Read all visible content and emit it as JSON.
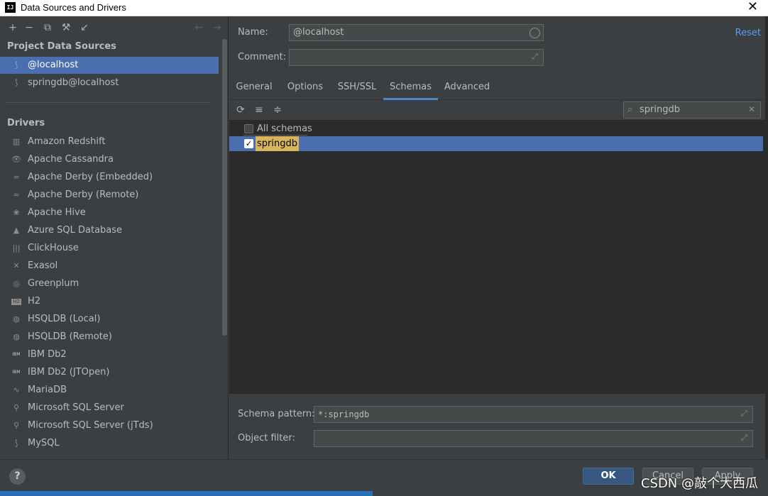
{
  "window": {
    "title": "Data Sources and Drivers",
    "app_icon": "IJ",
    "close_icon": "✕"
  },
  "left_toolbar": {
    "icons": [
      "add-icon",
      "remove-icon",
      "copy-icon",
      "wrench-icon",
      "import-icon",
      "back-arrow-icon",
      "forward-arrow-icon"
    ]
  },
  "project_sources": {
    "title": "Project Data Sources",
    "items": [
      {
        "label": "@localhost",
        "selected": true
      },
      {
        "label": "springdb@localhost",
        "selected": false
      }
    ]
  },
  "drivers": {
    "title": "Drivers",
    "items": [
      {
        "label": "Amazon Redshift",
        "icon": "▥"
      },
      {
        "label": "Apache Cassandra",
        "icon": "👁"
      },
      {
        "label": "Apache Derby (Embedded)",
        "icon": "≈"
      },
      {
        "label": "Apache Derby (Remote)",
        "icon": "≈"
      },
      {
        "label": "Apache Hive",
        "icon": "❀"
      },
      {
        "label": "Azure SQL Database",
        "icon": "▲"
      },
      {
        "label": "ClickHouse",
        "icon": "|||"
      },
      {
        "label": "Exasol",
        "icon": "✕"
      },
      {
        "label": "Greenplum",
        "icon": "◎"
      },
      {
        "label": "H2",
        "icon": "H2"
      },
      {
        "label": "HSQLDB (Local)",
        "icon": "◍"
      },
      {
        "label": "HSQLDB (Remote)",
        "icon": "◍"
      },
      {
        "label": "IBM Db2",
        "icon": "IBM"
      },
      {
        "label": "IBM Db2 (JTOpen)",
        "icon": "IBM"
      },
      {
        "label": "MariaDB",
        "icon": "∿"
      },
      {
        "label": "Microsoft SQL Server",
        "icon": "⚲"
      },
      {
        "label": "Microsoft SQL Server (jTds)",
        "icon": "⚲"
      },
      {
        "label": "MySQL",
        "icon": "⟆"
      }
    ]
  },
  "form": {
    "name_label": "Name:",
    "name_value": "@localhost",
    "comment_label": "Comment:",
    "comment_value": "",
    "reset_label": "Reset"
  },
  "tabs": [
    {
      "label": "General",
      "active": false
    },
    {
      "label": "Options",
      "active": false
    },
    {
      "label": "SSH/SSL",
      "active": false
    },
    {
      "label": "Schemas",
      "active": true
    },
    {
      "label": "Advanced",
      "active": false
    }
  ],
  "schemas": {
    "toolbar_icons": [
      "refresh-icon",
      "expand-all-icon",
      "collapse-all-icon"
    ],
    "search_value": "springdb",
    "rows": [
      {
        "label": "All schemas",
        "checked": false,
        "selected": false
      },
      {
        "label": "springdb",
        "checked": true,
        "selected": true
      }
    ]
  },
  "patterns": {
    "schema_pattern_label": "Schema pattern:",
    "schema_pattern_value": "*:springdb",
    "object_filter_label": "Object filter:",
    "object_filter_value": ""
  },
  "footer": {
    "help_label": "?",
    "ok_label": "OK",
    "cancel_label": "Cancel",
    "apply_label": "Apply"
  },
  "watermark": "CSDN @敲个大西瓜",
  "colors": {
    "selection": "#4b6eaf",
    "link": "#589df6",
    "panel": "#3c3f41",
    "list_bg": "#2b2b2b"
  }
}
